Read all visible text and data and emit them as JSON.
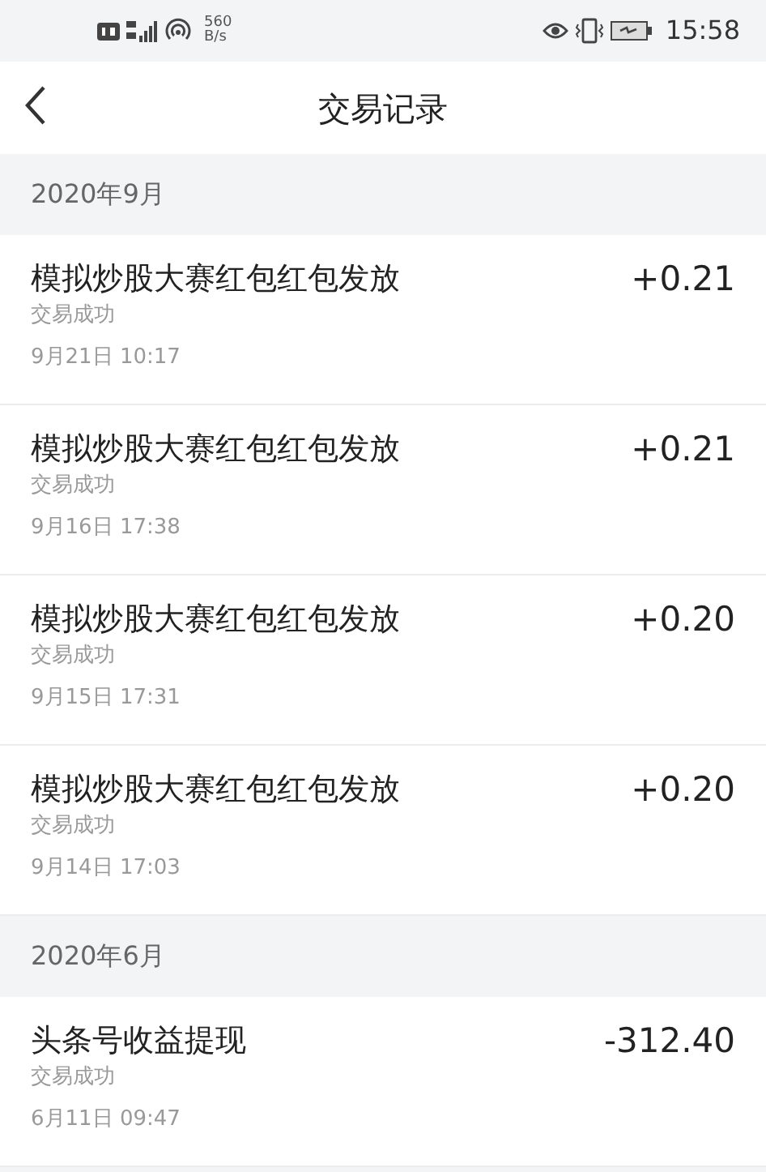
{
  "status_bar": {
    "speed_value": "560",
    "speed_unit": "B/s",
    "time": "15:58"
  },
  "header": {
    "title": "交易记录"
  },
  "sections": [
    {
      "month": "2020年9月",
      "records": [
        {
          "title": "模拟炒股大赛红包红包发放",
          "status": "交易成功",
          "time": "9月21日 10:17",
          "amount": "+0.21"
        },
        {
          "title": "模拟炒股大赛红包红包发放",
          "status": "交易成功",
          "time": "9月16日 17:38",
          "amount": "+0.21"
        },
        {
          "title": "模拟炒股大赛红包红包发放",
          "status": "交易成功",
          "time": "9月15日 17:31",
          "amount": "+0.20"
        },
        {
          "title": "模拟炒股大赛红包红包发放",
          "status": "交易成功",
          "time": "9月14日 17:03",
          "amount": "+0.20"
        }
      ]
    },
    {
      "month": "2020年6月",
      "records": [
        {
          "title": "头条号收益提现",
          "status": "交易成功",
          "time": "6月11日 09:47",
          "amount": "-312.40"
        }
      ]
    }
  ]
}
